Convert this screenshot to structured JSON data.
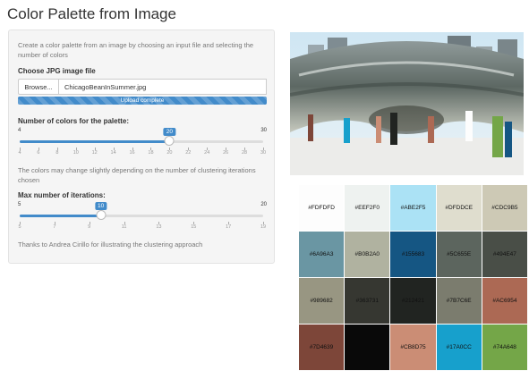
{
  "title": "Color Palette from Image",
  "sidebar": {
    "description": "Create a color palette from an image by choosing an input file and selecting the number of colors",
    "file_label": "Choose JPG image file",
    "browse_label": "Browse...",
    "file_name": "ChicagoBeanInSummer.jpg",
    "upload_status": "Upload complete",
    "upload_progress": 1.0,
    "colors_slider": {
      "label": "Number of colors for the palette:",
      "min": 4,
      "max": 30,
      "value": 20,
      "min_label": "4",
      "max_label": "30",
      "value_label": "20",
      "ticks": [
        "4",
        "6",
        "8",
        "10",
        "12",
        "14",
        "16",
        "18",
        "20",
        "22",
        "24",
        "26",
        "28",
        "30"
      ]
    },
    "note1": "The colors may change slightly depending on the number of clustering iterations chosen",
    "iter_slider": {
      "label": "Max number of iterations:",
      "min": 5,
      "max": 20,
      "value": 10,
      "min_label": "5",
      "max_label": "20",
      "value_label": "10",
      "ticks": [
        "5",
        "7",
        "9",
        "11",
        "13",
        "15",
        "17",
        "19"
      ]
    },
    "note2": "Thanks to Andrea Cirillo for illustrating the clustering approach"
  },
  "palette": [
    {
      "hex": "#FDFDFD",
      "label": "#FDFDFD"
    },
    {
      "hex": "#EEF2F0",
      "label": "#EEF2F0"
    },
    {
      "hex": "#ABE2F5",
      "label": "#ABE2F5"
    },
    {
      "hex": "#DFDDCE",
      "label": "#DFDDCE"
    },
    {
      "hex": "#CDC9B5",
      "label": "#CDC9B5"
    },
    {
      "hex": "#6A96A3",
      "label": "#6A96A3"
    },
    {
      "hex": "#B0B2A0",
      "label": "#B0B2A0"
    },
    {
      "hex": "#155683",
      "label": "#155683"
    },
    {
      "hex": "#5C655E",
      "label": "#5C655E"
    },
    {
      "hex": "#494E47",
      "label": "#494E47"
    },
    {
      "hex": "#989682",
      "label": "#989682"
    },
    {
      "hex": "#363731",
      "label": "#363731"
    },
    {
      "hex": "#212421",
      "label": "#212421"
    },
    {
      "hex": "#7B7C6E",
      "label": "#7B7C6E"
    },
    {
      "hex": "#AC6954",
      "label": "#AC6954"
    },
    {
      "hex": "#7D4639",
      "label": "#7D4639"
    },
    {
      "hex": "#090909",
      "label": ""
    },
    {
      "hex": "#CB8D75",
      "label": "#CB8D75"
    },
    {
      "hex": "#17A0CC",
      "label": "#17A0CC"
    },
    {
      "hex": "#74A648",
      "label": "#74A648"
    }
  ]
}
